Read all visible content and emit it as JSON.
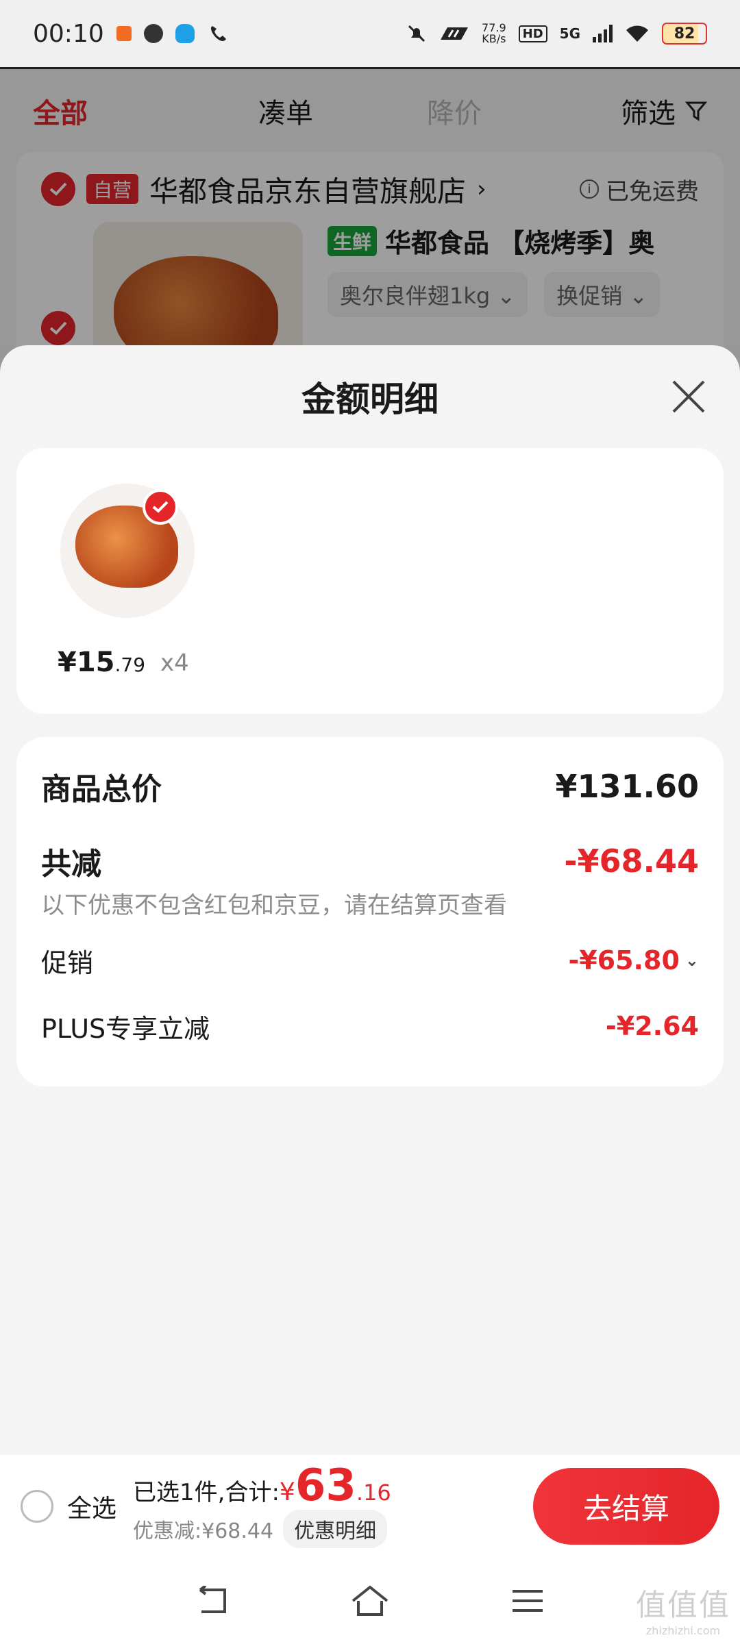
{
  "status_bar": {
    "time": "00:10",
    "net_speed_value": "77.9",
    "net_speed_unit": "KB/s",
    "hd": "HD",
    "network": "5G",
    "battery": "82"
  },
  "cart": {
    "tabs": [
      "全部",
      "凑单",
      "降价",
      "筛选"
    ],
    "store": {
      "tag": "自营",
      "name": "华都食品京东自营旗舰店",
      "shipping": "已免运费"
    },
    "product": {
      "tag": "生鲜",
      "title": "华都食品 【烧烤季】奥",
      "spec": "奥尔良伴翅1kg",
      "promo": "换促销"
    }
  },
  "sheet": {
    "title": "金额明细",
    "item": {
      "price_main": "¥15",
      "price_dec": ".79",
      "qty": "x4"
    },
    "summary": {
      "total_label": "商品总价",
      "total_value": "¥131.60",
      "reduce_label": "共减",
      "reduce_value": "-¥68.44",
      "note": "以下优惠不包含红包和京豆，请在结算页查看",
      "promo_label": "促销",
      "promo_value": "-¥65.80",
      "plus_label": "PLUS专享立减",
      "plus_value": "-¥2.64"
    }
  },
  "action_bar": {
    "select_all": "全选",
    "selected_text": "已选1件,合计:",
    "currency": "¥",
    "total_int": "63",
    "total_dec": ".16",
    "discount_text": "优惠减:¥68.44",
    "discount_detail_btn": "优惠明细",
    "checkout": "去结算"
  },
  "watermark": {
    "big": "值值值",
    "small": "zhizhizhi.com"
  },
  "colors": {
    "accent": "#e4262b",
    "fresh_green": "#19a33a",
    "muted_text": "#8c8c8c"
  },
  "icons": [
    "check-icon",
    "close-icon",
    "filter-icon",
    "chevron-right-icon",
    "chevron-down-icon",
    "info-icon",
    "back-icon",
    "home-icon",
    "menu-icon"
  ]
}
